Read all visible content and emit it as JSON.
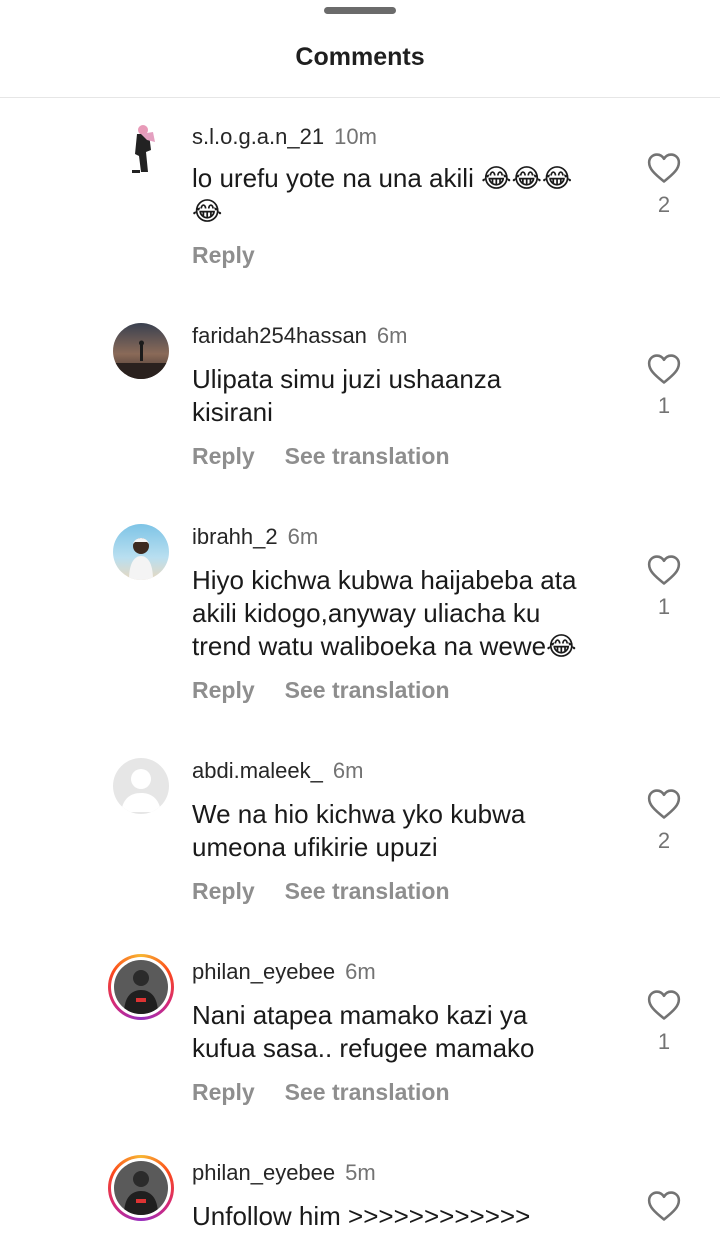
{
  "header": {
    "title": "Comments"
  },
  "comments": [
    {
      "username": "s.l.o.g.a.n_21",
      "time": "10m",
      "text_line1": "lo urefu yote na una akili 😂😂😂",
      "text_line2": "😂",
      "reply": "Reply",
      "likes": "2"
    },
    {
      "username": "faridah254hassan",
      "time": "6m",
      "text_line1": "Ulipata simu juzi ushaanza",
      "text_line2": "kisirani",
      "reply": "Reply",
      "translate": "See translation",
      "likes": "1"
    },
    {
      "username": "ibrahh_2",
      "time": "6m",
      "text_line1": "Hiyo kichwa kubwa haijabeba ata",
      "text_line2": "akili kidogo,anyway uliacha ku",
      "text_line3": "trend watu waliboeka na wewe😂",
      "reply": "Reply",
      "translate": "See translation",
      "likes": "1"
    },
    {
      "username": "abdi.maleek_",
      "time": "6m",
      "text_line1": "We na hio kichwa yko kubwa",
      "text_line2": "umeona ufikirie upuzi",
      "reply": "Reply",
      "translate": "See translation",
      "likes": "2"
    },
    {
      "username": "philan_eyebee",
      "time": "6m",
      "text_line1": "Nani atapea mamako kazi ya",
      "text_line2": "kufua  sasa.. refugee mamako",
      "reply": "Reply",
      "translate": "See translation",
      "likes": "1"
    },
    {
      "username": "philan_eyebee",
      "time": "5m",
      "text_line1": "Unfollow him >>>>>>>>>>>>"
    }
  ]
}
